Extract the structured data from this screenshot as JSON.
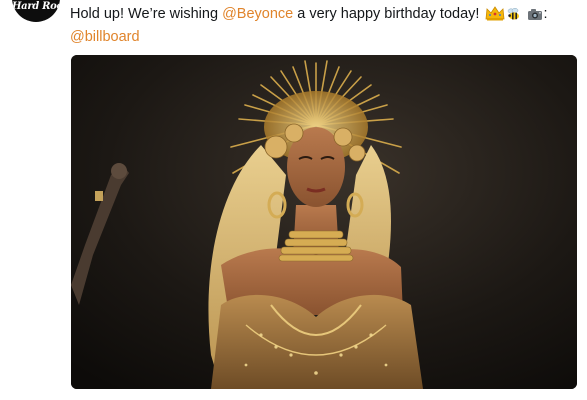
{
  "account": {
    "avatar_text": "Hard Rock"
  },
  "tweet": {
    "text_start": "Hold up! We’re wishing ",
    "mention_1": "@Beyonce",
    "text_middle": " a very happy birthday today!",
    "colon": ":",
    "mention_2": "@billboard",
    "emojis": [
      "crown-icon",
      "bee-icon",
      "camera-icon"
    ]
  },
  "colors": {
    "mention": "#e0842b",
    "text": "#14171a",
    "avatar_bg": "#0d0d0d"
  }
}
